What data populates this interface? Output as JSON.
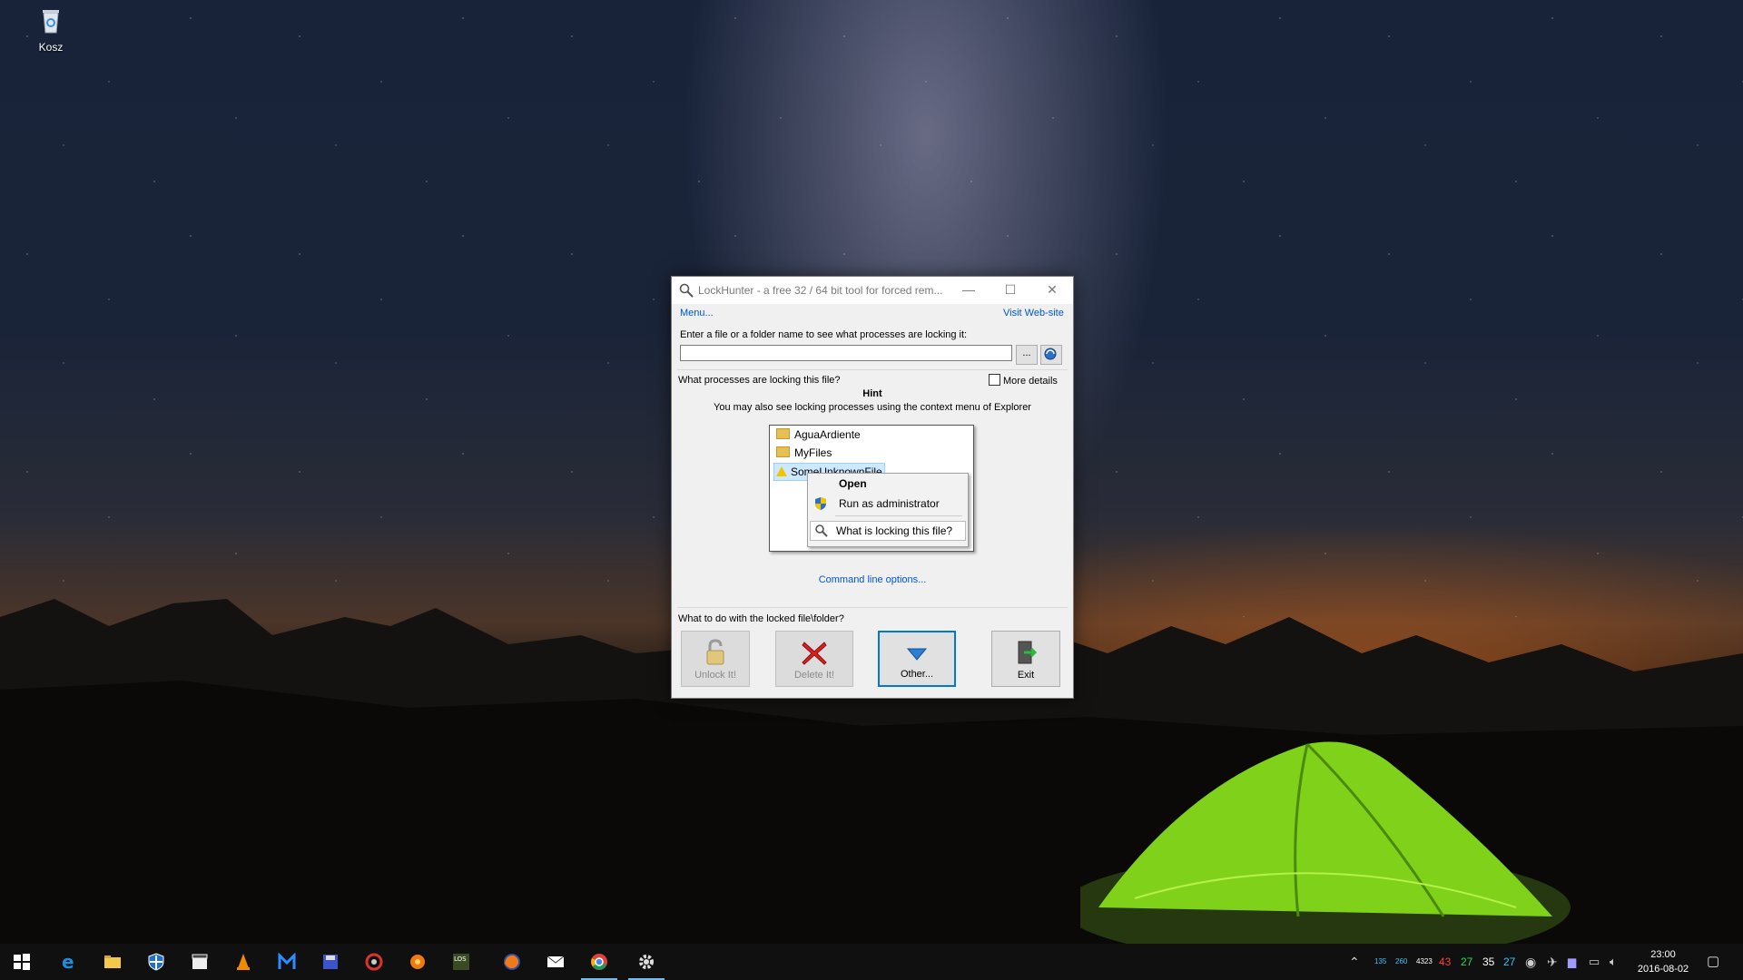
{
  "desktop": {
    "icons": [
      {
        "label": "Kosz",
        "icon": "recycle-bin-icon"
      }
    ]
  },
  "window": {
    "title": "LockHunter - a free 32 / 64 bit tool for forced rem...",
    "minimize": "—",
    "maximize": "☐",
    "close": "✕",
    "menu_link": "Menu...",
    "website_link": "Visit Web-site",
    "path_label": "Enter a file or a folder name to see what processes are locking it:",
    "path_value": "",
    "browse_label": "...",
    "question": "What processes are locking this file?",
    "more_details": "More details",
    "more_details_checked": false,
    "hint_title": "Hint",
    "hint_text": "You may also see locking processes using the context menu of Explorer",
    "hint_items": [
      "AguaArdiente",
      "MyFiles",
      "SomeUnknownFile"
    ],
    "context_menu": [
      "Open",
      "Run as administrator",
      "What is locking this file?"
    ],
    "command_line_link": "Command line options...",
    "action_question": "What to do with the locked file\\folder?",
    "buttons": {
      "unlock": "Unlock It!",
      "delete": "Delete It!",
      "other": "Other...",
      "exit": "Exit"
    }
  },
  "taskbar": {
    "apps": [
      "start",
      "edge",
      "file-explorer",
      "defender",
      "video-editor",
      "vlc",
      "malwarebytes",
      "floppy-save",
      "ccleaner",
      "media-player",
      "los-game",
      "firefox",
      "mail",
      "chrome",
      "lockhunter"
    ],
    "tray_numbers": [
      "135",
      "260",
      "4323",
      "43",
      "27",
      "35",
      "27"
    ],
    "tray_colors": [
      "#3cc3ff",
      "#3cc3ff",
      "#ffffff",
      "#ff3b3b",
      "#2edc4a",
      "#ffffff",
      "#3cc3ff"
    ],
    "time": "23:00",
    "date": "2016-08-02"
  }
}
